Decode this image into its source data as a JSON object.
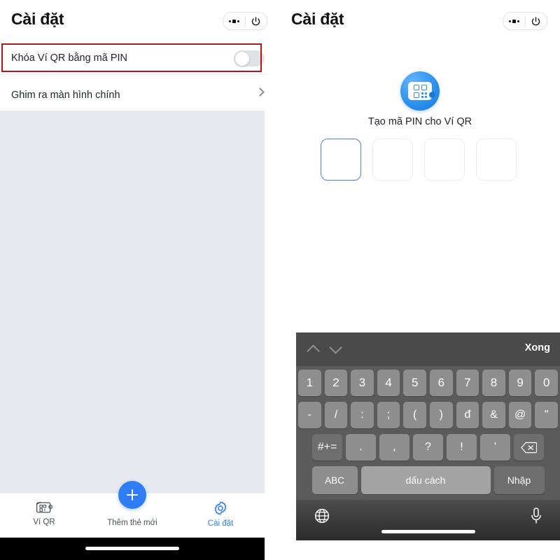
{
  "left_panel": {
    "header": {
      "title": "Cài đặt",
      "more_icon": "more-horizontal-icon",
      "power_icon": "power-icon"
    },
    "rows": [
      {
        "label": "Khóa Ví QR bằng mã PIN",
        "control": "toggle",
        "toggle_on": false
      },
      {
        "label": "Ghim ra màn hình chính",
        "control": "chevron"
      }
    ],
    "annotation": {
      "color": "#b3151a"
    },
    "tabbar": {
      "items": [
        {
          "label": "Ví QR",
          "icon": "qr-wallet-icon",
          "active": false
        },
        {
          "label": "Thêm thẻ mới",
          "icon": "plus-icon",
          "active": false
        },
        {
          "label": "Cài đặt",
          "icon": "gear-icon",
          "active": true
        }
      ],
      "active_color": "#2f7df6"
    }
  },
  "right_panel": {
    "header": {
      "title": "Cài đặt",
      "more_icon": "more-horizontal-icon",
      "power_icon": "power-icon"
    },
    "logo_icon": "qr-wallet-circle-icon",
    "pin_caption": "Tạo mã PIN cho Ví QR",
    "pin_boxes": [
      {
        "value": "",
        "focused": true
      },
      {
        "value": "",
        "focused": false
      },
      {
        "value": "",
        "focused": false
      },
      {
        "value": "",
        "focused": false
      }
    ],
    "keyboard": {
      "toolbar": {
        "prev_icon": "chevron-up-icon",
        "next_icon": "chevron-down-icon",
        "done_label": "Xong"
      },
      "row1": [
        "1",
        "2",
        "3",
        "4",
        "5",
        "6",
        "7",
        "8",
        "9",
        "0"
      ],
      "row2": [
        "-",
        "/",
        ":",
        ";",
        "(",
        ")",
        "đ",
        "&",
        "@",
        "\""
      ],
      "row3_mod": "#+=",
      "row3": [
        ".",
        ",",
        "?",
        "!",
        "'"
      ],
      "row3_delete_icon": "backspace-icon",
      "row4": {
        "abc": "ABC",
        "space": "dấu cách",
        "return": "Nhập"
      },
      "bottom": {
        "globe_icon": "globe-icon",
        "mic_icon": "microphone-icon"
      }
    }
  }
}
